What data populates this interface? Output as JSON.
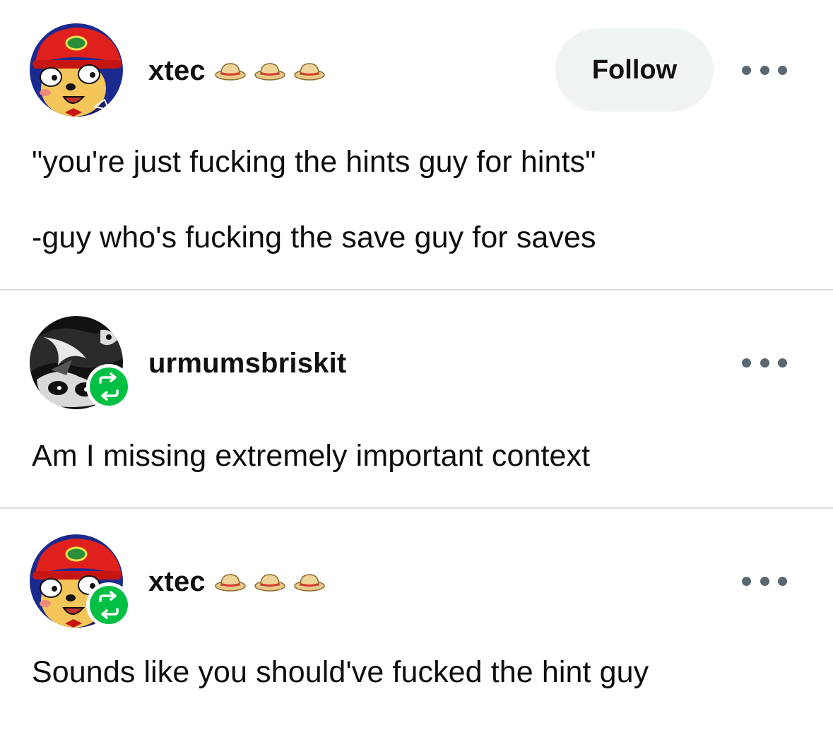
{
  "posts": [
    {
      "username": "xtec",
      "username_decoration_icon": "straw-hat-icon",
      "follow_label": "Follow",
      "lines": [
        "\"you're just fucking the hints guy for hints\"",
        "-guy who's fucking the save guy for saves"
      ]
    },
    {
      "username": "urmumsbriskit",
      "reblog_badge_icon": "reblog-icon",
      "lines": [
        "Am I missing extremely important context"
      ]
    },
    {
      "username": "xtec",
      "username_decoration_icon": "straw-hat-icon",
      "reblog_badge_icon": "reblog-icon",
      "lines": [
        "Sounds like you should've fucked the hint guy"
      ]
    }
  ],
  "colors": {
    "reblog_green": "#00c044",
    "follow_button_bg": "#f0f3f4",
    "divider": "#dcdcdc",
    "more_dots": "#5b6770"
  }
}
